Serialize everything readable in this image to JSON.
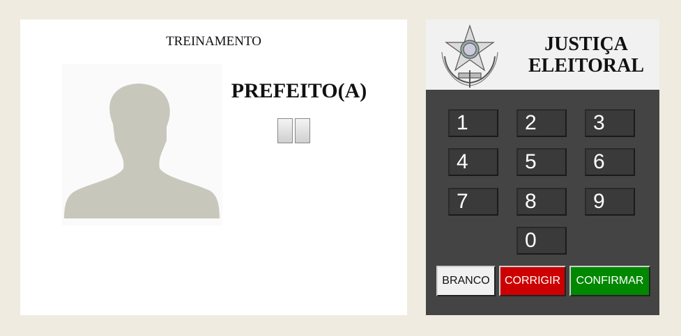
{
  "screen": {
    "header": "TREINAMENTO",
    "role": "PREFEITO(A)",
    "digits": [
      "",
      ""
    ]
  },
  "panel": {
    "brand_line1": "JUSTIÇA",
    "brand_line2": "ELEITORAL",
    "keys": [
      "1",
      "2",
      "3",
      "4",
      "5",
      "6",
      "7",
      "8",
      "9",
      "0"
    ],
    "buttons": {
      "branco": "BRANCO",
      "corrigir": "CORRIGIR",
      "confirmar": "CONFIRMAR"
    }
  },
  "colors": {
    "background": "#efebe0",
    "panel": "#444444",
    "branco": "#f1f1f1",
    "corrigir": "#cc0000",
    "confirmar": "#008800",
    "silhouette": "#c7c7bc"
  },
  "icons": {
    "photo": "person-silhouette-icon",
    "emblem": "coat-of-arms-icon"
  }
}
